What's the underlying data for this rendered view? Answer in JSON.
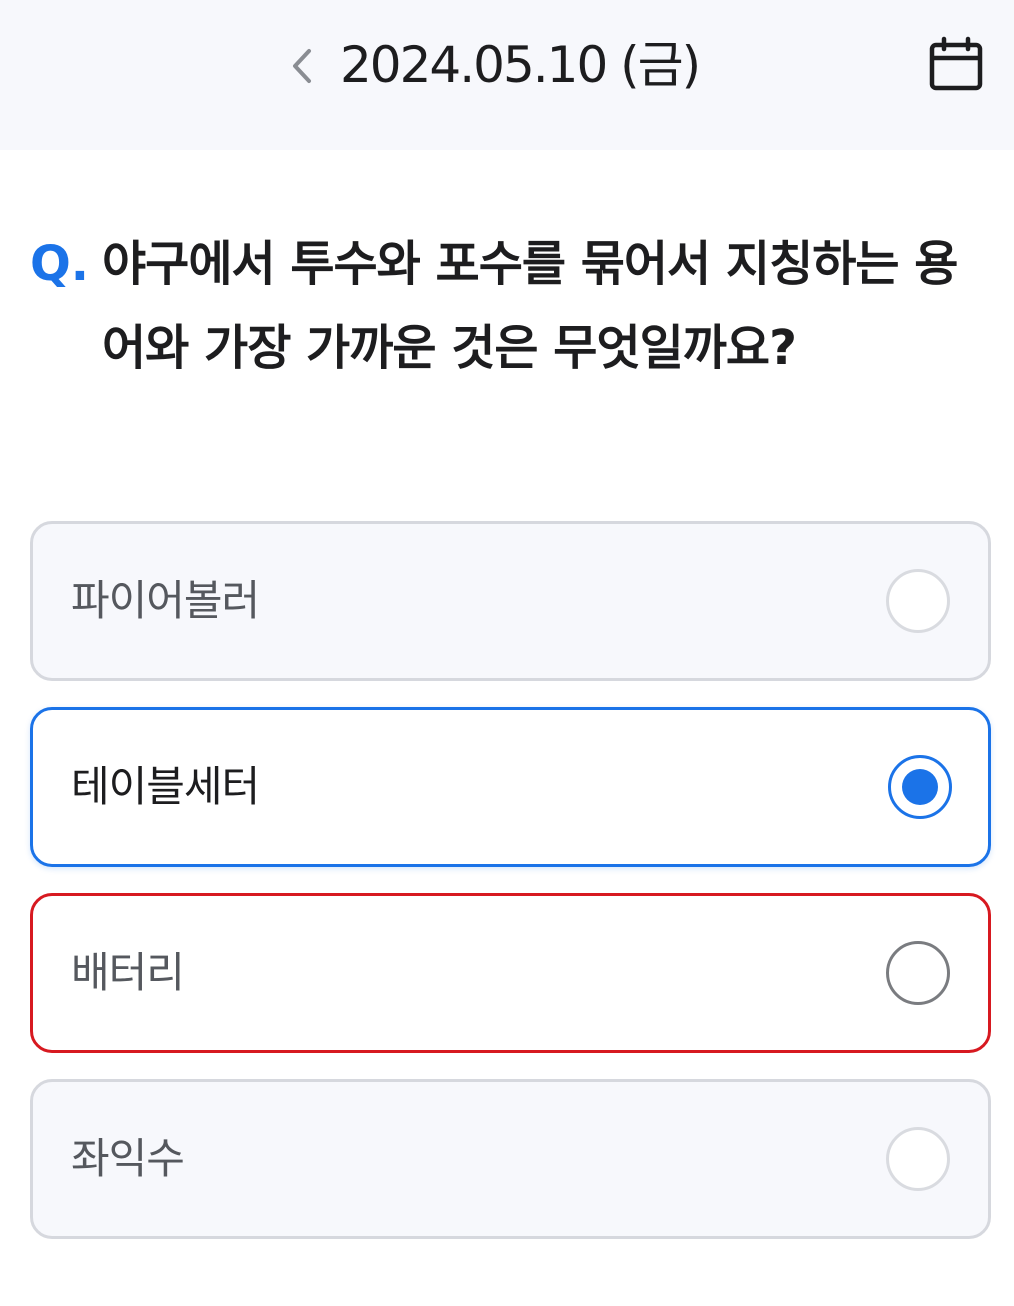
{
  "header": {
    "date": "2024.05.10 (금)",
    "back_icon": "chevron-left-icon",
    "calendar_icon": "calendar-icon"
  },
  "question": {
    "prefix": "Q.",
    "text": "야구에서 투수와 포수를 묶어서 지칭하는 용어와 가장 가까운 것은 무엇일까요?"
  },
  "options": [
    {
      "label": "파이어볼러",
      "state": "default"
    },
    {
      "label": "테이블세터",
      "state": "selected"
    },
    {
      "label": "배터리",
      "state": "wrong"
    },
    {
      "label": "좌익수",
      "state": "default"
    }
  ],
  "colors": {
    "accent": "#1b73e8",
    "wrong": "#d71920",
    "header_bg": "#f7f8fc",
    "option_bg": "#f7f8fc"
  }
}
